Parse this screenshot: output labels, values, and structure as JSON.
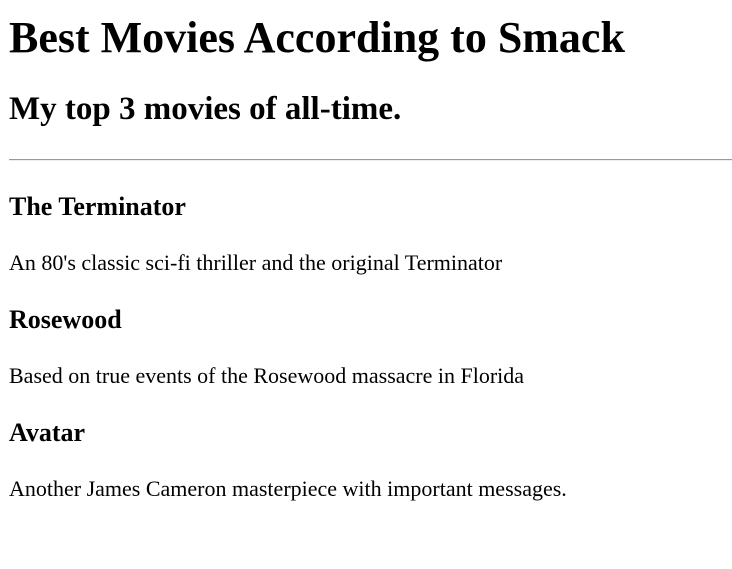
{
  "page": {
    "title": "Best Movies According to Smack",
    "subtitle": "My top 3 movies of all-time."
  },
  "movies": [
    {
      "title": "The Terminator",
      "description": "An 80's classic sci-fi thriller and the original Terminator"
    },
    {
      "title": "Rosewood",
      "description": "Based on true events of the Rosewood massacre in Florida"
    },
    {
      "title": "Avatar",
      "description": "Another James Cameron masterpiece with important messages."
    }
  ]
}
